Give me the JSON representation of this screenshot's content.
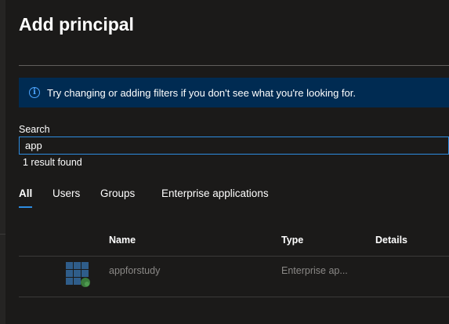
{
  "dialog": {
    "title": "Add principal"
  },
  "info_bar": {
    "icon": "info-icon",
    "message": "Try changing or adding filters if you don't see what you're looking for."
  },
  "search": {
    "label": "Search",
    "value": "app",
    "result_count": "1 result found"
  },
  "tabs": [
    {
      "label": "All",
      "active": true
    },
    {
      "label": "Users",
      "active": false
    },
    {
      "label": "Groups",
      "active": false
    },
    {
      "label": "Enterprise applications",
      "active": false
    }
  ],
  "table": {
    "columns": [
      "Name",
      "Type",
      "Details"
    ],
    "rows": [
      {
        "icon": "enterprise-app-icon",
        "name": "appforstudy",
        "type": "Enterprise ap...",
        "details": ""
      }
    ]
  },
  "colors": {
    "background": "#1b1a19",
    "info_bar": "#002b52",
    "accent": "#2d8ce0",
    "muted_text": "#8a8886"
  }
}
